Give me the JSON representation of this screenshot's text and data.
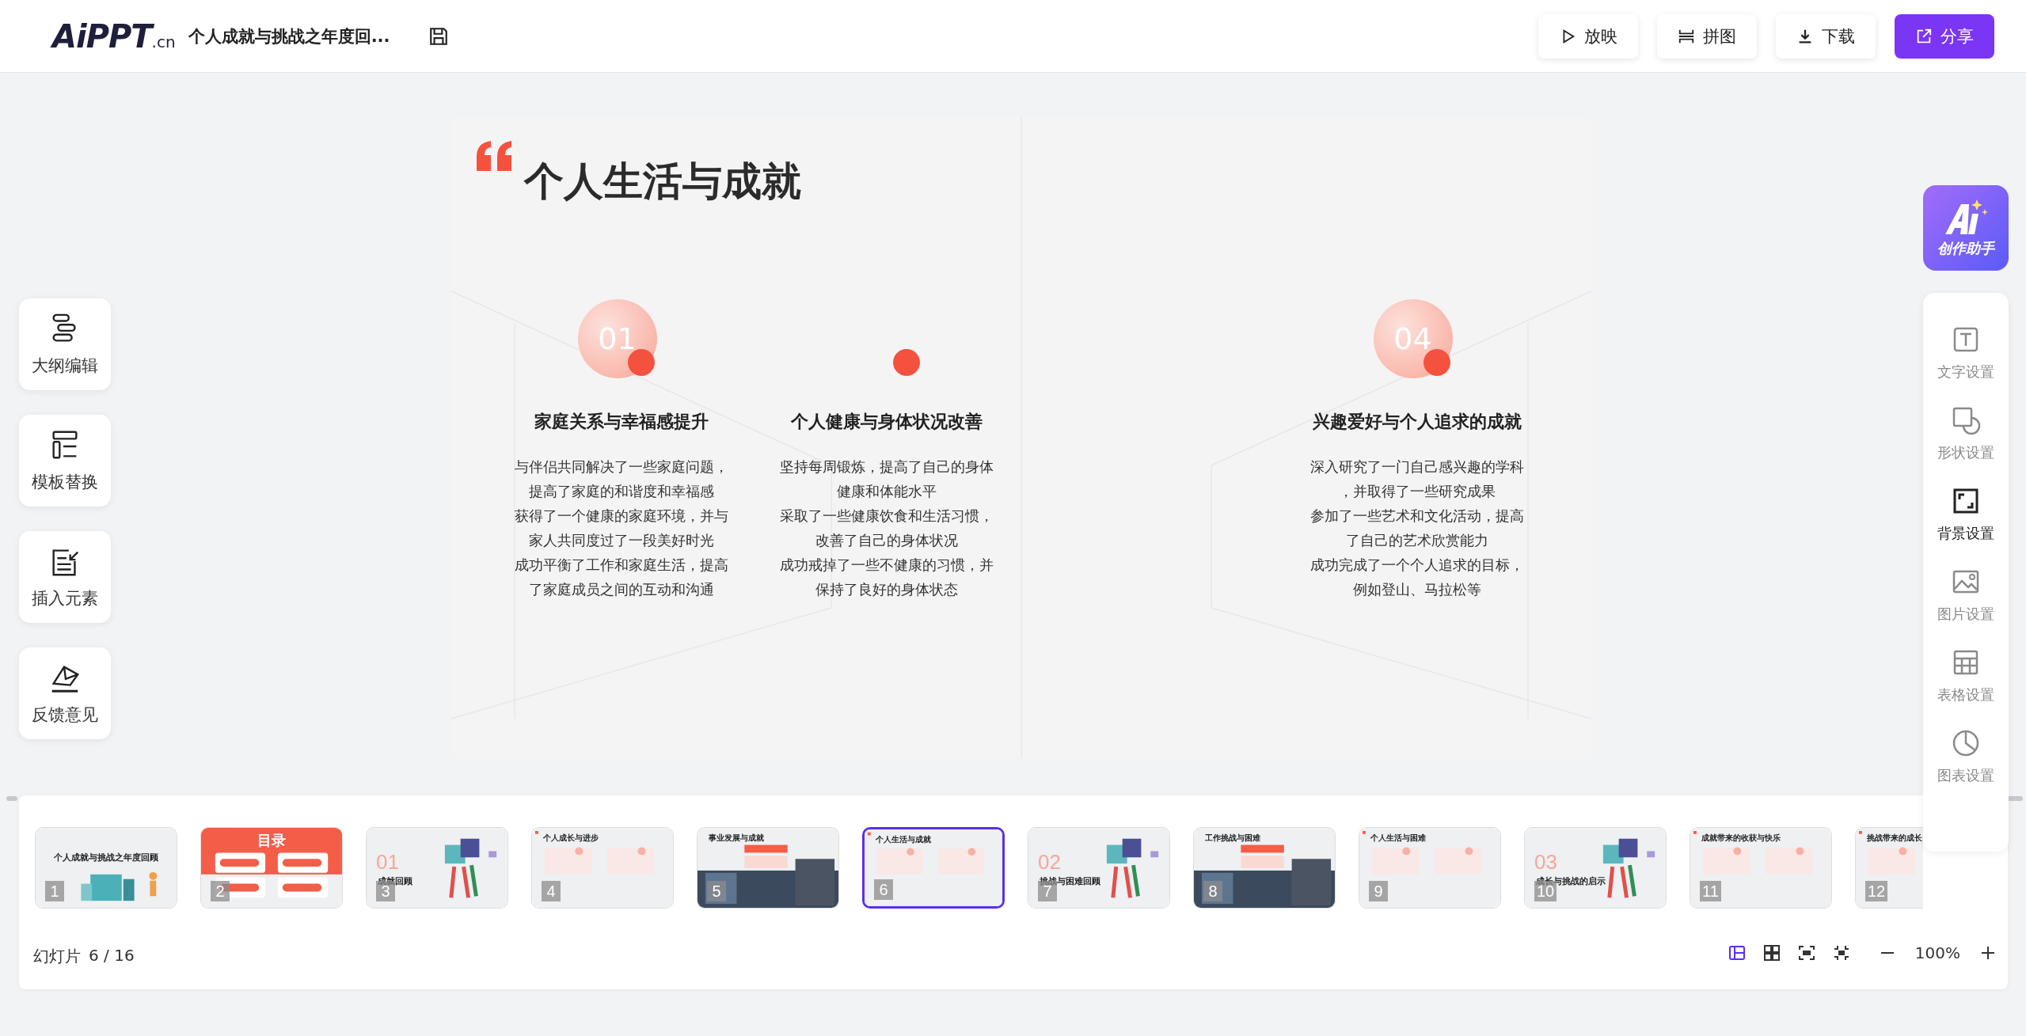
{
  "header": {
    "logo_main": "AiPPT",
    "logo_suffix": ".cn",
    "doc_title": "个人成就与挑战之年度回...",
    "actions": [
      {
        "kind": "play",
        "label": "放映",
        "primary": false
      },
      {
        "kind": "collage",
        "label": "拼图",
        "primary": false
      },
      {
        "kind": "download",
        "label": "下载",
        "primary": false
      },
      {
        "kind": "share",
        "label": "分享",
        "primary": true
      }
    ]
  },
  "left_tools": [
    {
      "kind": "outline",
      "label": "大纲编辑"
    },
    {
      "kind": "template",
      "label": "模板替换"
    },
    {
      "kind": "insert",
      "label": "插入元素"
    },
    {
      "kind": "feedback",
      "label": "反馈意见"
    }
  ],
  "slide": {
    "title": "个人生活与成就",
    "columns": [
      {
        "kind": "full",
        "number": "01",
        "heading": "家庭关系与幸福感提升",
        "lines": [
          "与伴侣共同解决了一些家庭问题，",
          "提高了家庭的和谐度和幸福感",
          "获得了一个健康的家庭环境，并与",
          "家人共同度过了一段美好时光",
          "成功平衡了工作和家庭生活，提高",
          "了家庭成员之间的互动和沟通"
        ]
      },
      {
        "kind": "dot",
        "heading": "个人健康与身体状况改善",
        "lines": [
          "坚持每周锻炼，提高了自己的身体",
          "健康和体能水平",
          "采取了一些健康饮食和生活习惯，",
          "改善了自己的身体状况",
          "成功戒掉了一些不健康的习惯，并",
          "保持了良好的身体状态"
        ]
      },
      {
        "kind": "empty"
      },
      {
        "kind": "full",
        "number": "04",
        "heading": "兴趣爱好与个人追求的成就",
        "lines": [
          "深入研究了一门自己感兴趣的学科",
          "，并取得了一些研究成果",
          "参加了一些艺术和文化活动，提高",
          "了自己的艺术欣赏能力",
          "成功完成了一个个人追求的目标，",
          "例如登山、马拉松等"
        ]
      }
    ]
  },
  "ai_assistant": {
    "label": "创作助手"
  },
  "right_tools": [
    {
      "kind": "text",
      "label": "文字设置",
      "selected": false
    },
    {
      "kind": "shape",
      "label": "形状设置",
      "selected": false
    },
    {
      "kind": "background",
      "label": "背景设置",
      "selected": true
    },
    {
      "kind": "image",
      "label": "图片设置",
      "selected": false
    },
    {
      "kind": "table",
      "label": "表格设置",
      "selected": false
    },
    {
      "kind": "chart",
      "label": "图表设置",
      "selected": false
    }
  ],
  "thumbnails": [
    {
      "kind": "cover",
      "number": "1",
      "title": "个人成就与挑战之年度回顾",
      "selected": false
    },
    {
      "kind": "toc",
      "number": "2",
      "title": "目录",
      "selected": false
    },
    {
      "kind": "section",
      "number": "3",
      "section_number": "01",
      "title": "成就回顾",
      "selected": false
    },
    {
      "kind": "content",
      "number": "4",
      "title": "个人成长与进步",
      "selected": false
    },
    {
      "kind": "photo",
      "number": "5",
      "title": "事业发展与成就",
      "selected": false
    },
    {
      "kind": "content",
      "number": "6",
      "title": "个人生活与成就",
      "selected": true
    },
    {
      "kind": "section",
      "number": "7",
      "section_number": "02",
      "title": "挑战与困难回顾",
      "selected": false
    },
    {
      "kind": "photo",
      "number": "8",
      "title": "工作挑战与困难",
      "selected": false
    },
    {
      "kind": "content",
      "number": "9",
      "title": "个人生活与困难",
      "selected": false
    },
    {
      "kind": "section",
      "number": "10",
      "section_number": "03",
      "title": "成长与挑战的启示",
      "selected": false
    },
    {
      "kind": "content",
      "number": "11",
      "title": "成就带来的收获与快乐",
      "selected": false
    },
    {
      "kind": "content",
      "number": "12",
      "title": "挑战带来的成长",
      "selected": false
    }
  ],
  "footer": {
    "slide_label": "幻灯片",
    "slide_count": "6 / 16",
    "views": [
      {
        "kind": "normal",
        "selected": true
      },
      {
        "kind": "grid",
        "selected": false
      },
      {
        "kind": "fit",
        "selected": false
      },
      {
        "kind": "full",
        "selected": false
      }
    ],
    "zoom": "100%"
  }
}
